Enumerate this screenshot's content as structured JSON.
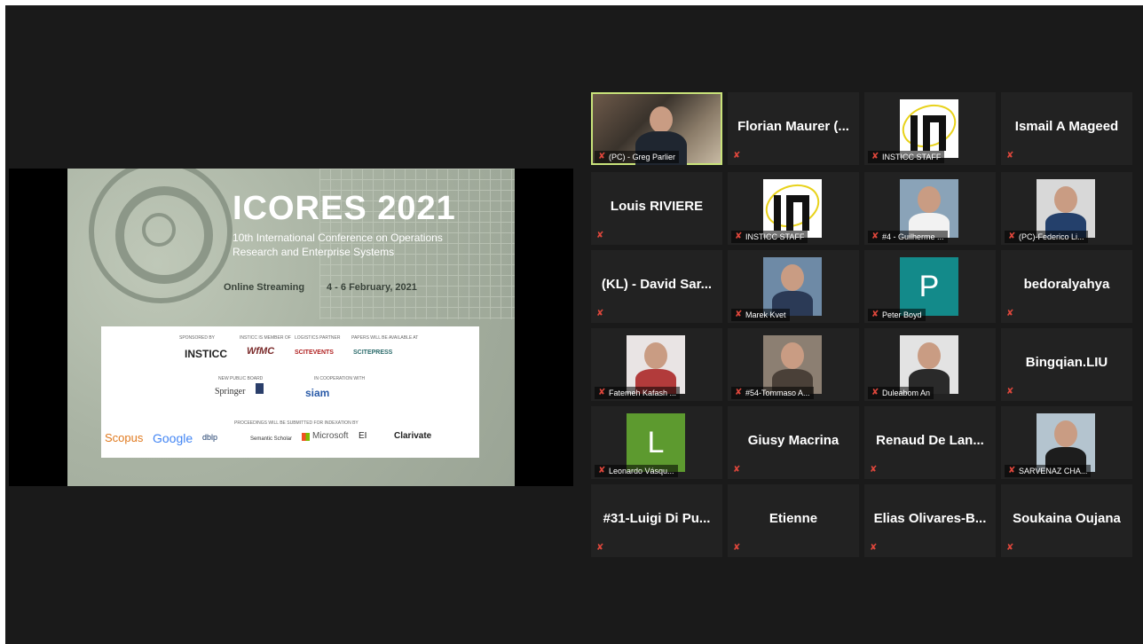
{
  "slide": {
    "title": "ICORES 2021",
    "subtitle_line1": "10th International Conference on Operations",
    "subtitle_line2": "Research and Enterprise Systems",
    "streaming": "Online Streaming",
    "dates": "4 - 6 February, 2021",
    "sponsor_headers": [
      "SPONSORED BY",
      "INSTICC IS MEMBER OF",
      "LOGISTICS PARTNER",
      "PAPERS WILL BE AVAILABLE AT"
    ],
    "sponsor_logos": [
      "INSTICC",
      "WfMC",
      "SCITEVENTS",
      "SCITEPRESS"
    ],
    "publisher_header": "NEW PUBLIC BOARD",
    "cooperation_header": "IN COOPERATION WITH",
    "publisher_logo": "Springer",
    "cooperation_logo": "siam",
    "indexing_header": "PROCEEDINGS WILL BE SUBMITTED FOR INDEXATION BY",
    "indexers": [
      "Scopus",
      "Google",
      "dblp",
      "Semantic Scholar",
      "Microsoft",
      "EI",
      "Clarivate"
    ]
  },
  "participants": [
    {
      "label": "(PC) - Greg Parlier",
      "type": "video",
      "active": true
    },
    {
      "name": "Florian Maurer (...",
      "type": "name"
    },
    {
      "label": "INSTICC STAFF",
      "type": "insticc"
    },
    {
      "name": "Ismail A Mageed",
      "type": "name"
    },
    {
      "name": "Louis RIVIERE",
      "type": "name"
    },
    {
      "label": "INSTICC STAFF",
      "type": "insticc"
    },
    {
      "label": "#4 - Guilherme ...",
      "type": "photo",
      "bg": "#8aa3b8",
      "shirt": "#f2f2f2"
    },
    {
      "label": "(PC)-Federico Li...",
      "type": "photo",
      "bg": "#d8d8d8",
      "shirt": "#24406b"
    },
    {
      "name": "(KL) - David Sar...",
      "type": "name"
    },
    {
      "label": "Marek Kvet",
      "type": "photo",
      "bg": "#6e8aa6",
      "shirt": "#2b3a56"
    },
    {
      "label": "Peter Boyd",
      "type": "letter",
      "letter": "P",
      "bg": "#138a8a"
    },
    {
      "name": "bedoralyahya",
      "type": "name"
    },
    {
      "label": "Fatemeh Kafash ...",
      "type": "photo",
      "bg": "#e9e4e4",
      "shirt": "#b23b3b"
    },
    {
      "label": "#54-Tommaso A...",
      "type": "photo",
      "bg": "#8c7f72",
      "shirt": "#4a4038"
    },
    {
      "label": "Duleabom An",
      "type": "photo",
      "bg": "#e3e3e3",
      "shirt": "#2a2a2a"
    },
    {
      "name": "Bingqian.LIU",
      "type": "name"
    },
    {
      "label": "Leonardo Vásqu...",
      "type": "letter",
      "letter": "L",
      "bg": "#5d9a2f"
    },
    {
      "name": "Giusy Macrina",
      "type": "name"
    },
    {
      "name": "Renaud De Lan...",
      "type": "name"
    },
    {
      "label": "SARVENAZ CHA...",
      "type": "photo",
      "bg": "#b4c4cf",
      "shirt": "#1d1d1d"
    },
    {
      "name": "#31-Luigi Di Pu...",
      "type": "name"
    },
    {
      "name": "Etienne",
      "type": "name"
    },
    {
      "name": "Elias Olivares-B...",
      "type": "name"
    },
    {
      "name": "Soukaina Oujana",
      "type": "name"
    }
  ]
}
